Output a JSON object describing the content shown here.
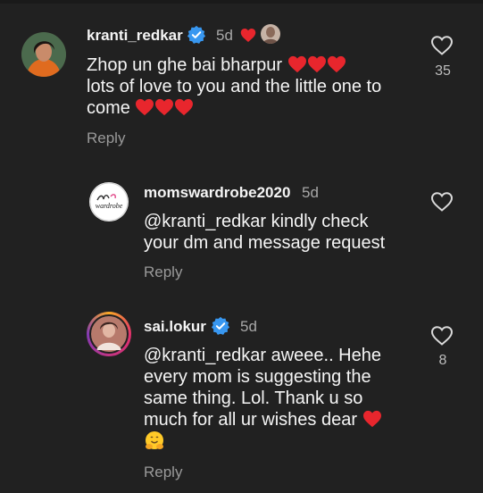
{
  "colors": {
    "background": "#212121",
    "heart_red": "#e8262d",
    "verified_blue": "#3897f0"
  },
  "comments": [
    {
      "username": "kranti_redkar",
      "time": "5d",
      "verified": true,
      "lines": [
        "Zhop un ghe bai bharpur",
        "lots of love to you and the little one to",
        "come"
      ],
      "reply_label": "Reply",
      "like_count": "35"
    },
    {
      "username": "momswardrobe2020",
      "time": "5d",
      "verified": false,
      "avatar_text": "wardrobe",
      "lines": [
        "@kranti_redkar kindly check",
        "your dm and message request"
      ],
      "reply_label": "Reply",
      "like_count": ""
    },
    {
      "username": "sai.lokur",
      "time": "5d",
      "verified": true,
      "lines": [
        "@kranti_redkar aweee.. Hehe",
        "every mom is suggesting the",
        "same thing. Lol. Thank u so",
        "much for all ur wishes dear"
      ],
      "reply_label": "Reply",
      "like_count": "8"
    }
  ]
}
